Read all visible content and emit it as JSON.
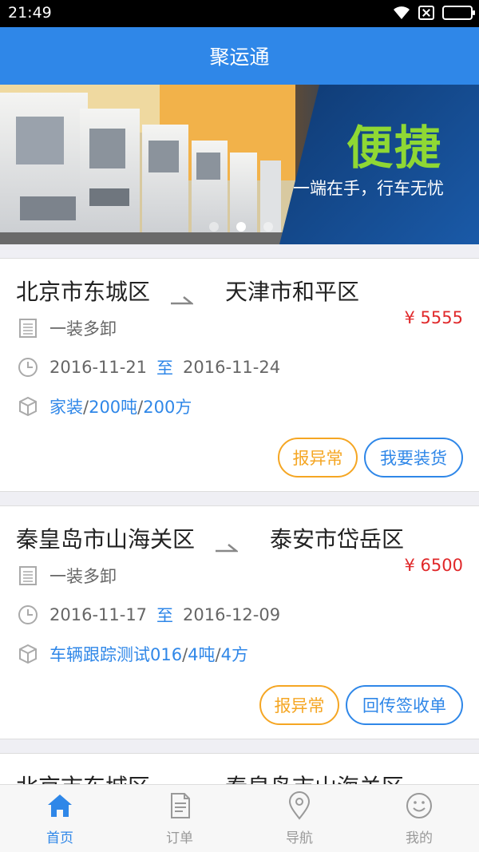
{
  "status_bar": {
    "time": "21:49"
  },
  "header": {
    "title": "聚运通"
  },
  "banner": {
    "headline": "便捷",
    "tagline": "一端在手，行车无忧",
    "dots": 3,
    "active_dot": 2
  },
  "orders": [
    {
      "origin": "北京市东城区",
      "destination": "天津市和平区",
      "load_type": "一装多卸",
      "price": "¥ 5555",
      "date_from": "2016-11-21",
      "date_to_label": "至",
      "date_to": "2016-11-24",
      "goods_name": "家装",
      "goods_weight": "200吨",
      "goods_volume": "200方",
      "button_report": "报异常",
      "button_action": "我要装货"
    },
    {
      "origin": "秦皇岛市山海关区",
      "destination": "泰安市岱岳区",
      "load_type": "一装多卸",
      "price": "¥ 6500",
      "date_from": "2016-11-17",
      "date_to_label": "至",
      "date_to": "2016-12-09",
      "goods_name": "车辆跟踪测试016",
      "goods_weight": "4吨",
      "goods_volume": "4方",
      "button_report": "报异常",
      "button_action": "回传签收单"
    },
    {
      "origin": "北京市东城区",
      "destination": "秦皇岛市山海关区"
    }
  ],
  "goods_separator": "/",
  "nav": {
    "home": "首页",
    "orders": "订单",
    "navigation": "导航",
    "mine": "我的"
  },
  "colors": {
    "primary": "#2f87e8",
    "price": "#e0282a",
    "warning": "#f5a623",
    "banner_accent": "#8fd834"
  }
}
